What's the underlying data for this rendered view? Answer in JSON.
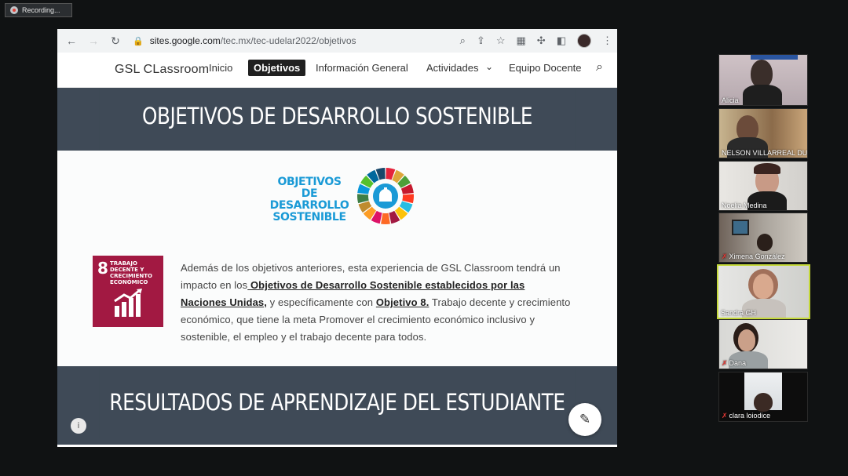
{
  "recording": {
    "label": "Recording..."
  },
  "browser": {
    "url_host": "sites.google.com",
    "url_path": "/tec.mx/tec-udelar2022/objetivos"
  },
  "site": {
    "brand": "GSL CLassroom",
    "nav": [
      "Inicio",
      "Objetivos",
      "Información General",
      "Actividades",
      "Equipo Docente"
    ]
  },
  "page": {
    "heading1": "OBJETIVOS DE DESARROLLO SOSTENIBLE",
    "logo_text": [
      "OBJETIVOS",
      "DE DESARROLLO",
      "SOSTENIBLE"
    ],
    "sdg8": {
      "number": "8",
      "label": "TRABAJO DECENTE Y CRECIMIENTO ECONÓMICO"
    },
    "paragraph": {
      "p1": "Además de los objetivos anteriores, esta experiencia de GSL Classroom tendrá un impacto en los",
      "link1": " Objetivos de Desarrollo Sostenible establecidos por las Naciones Unidas,",
      "p2": " y específicamente con ",
      "link2": "Objetivo 8.",
      "p3": " Trabajo decente y crecimiento económico,  que tiene la meta Promover el crecimiento económico inclusivo y sostenible, el empleo y el trabajo decente para todos."
    },
    "heading2": "RESULTADOS DE APRENDIZAJE DEL ESTUDIANTE"
  },
  "participants": [
    {
      "name": "Alicia",
      "muted": false
    },
    {
      "name": "NELSON VILLARREAL DU...",
      "muted": false
    },
    {
      "name": "Noelia Medina",
      "muted": false
    },
    {
      "name": "Ximena González",
      "muted": true
    },
    {
      "name": "Sandra GH",
      "muted": false,
      "speaking": true
    },
    {
      "name": "Dana",
      "muted": true
    },
    {
      "name": "clara loiodice",
      "muted": true
    }
  ],
  "colors": {
    "band": "#3f4a57",
    "sdg8": "#a21942",
    "sdg_blue": "#1a9ad6",
    "speaker_border": "#c4d83a"
  }
}
